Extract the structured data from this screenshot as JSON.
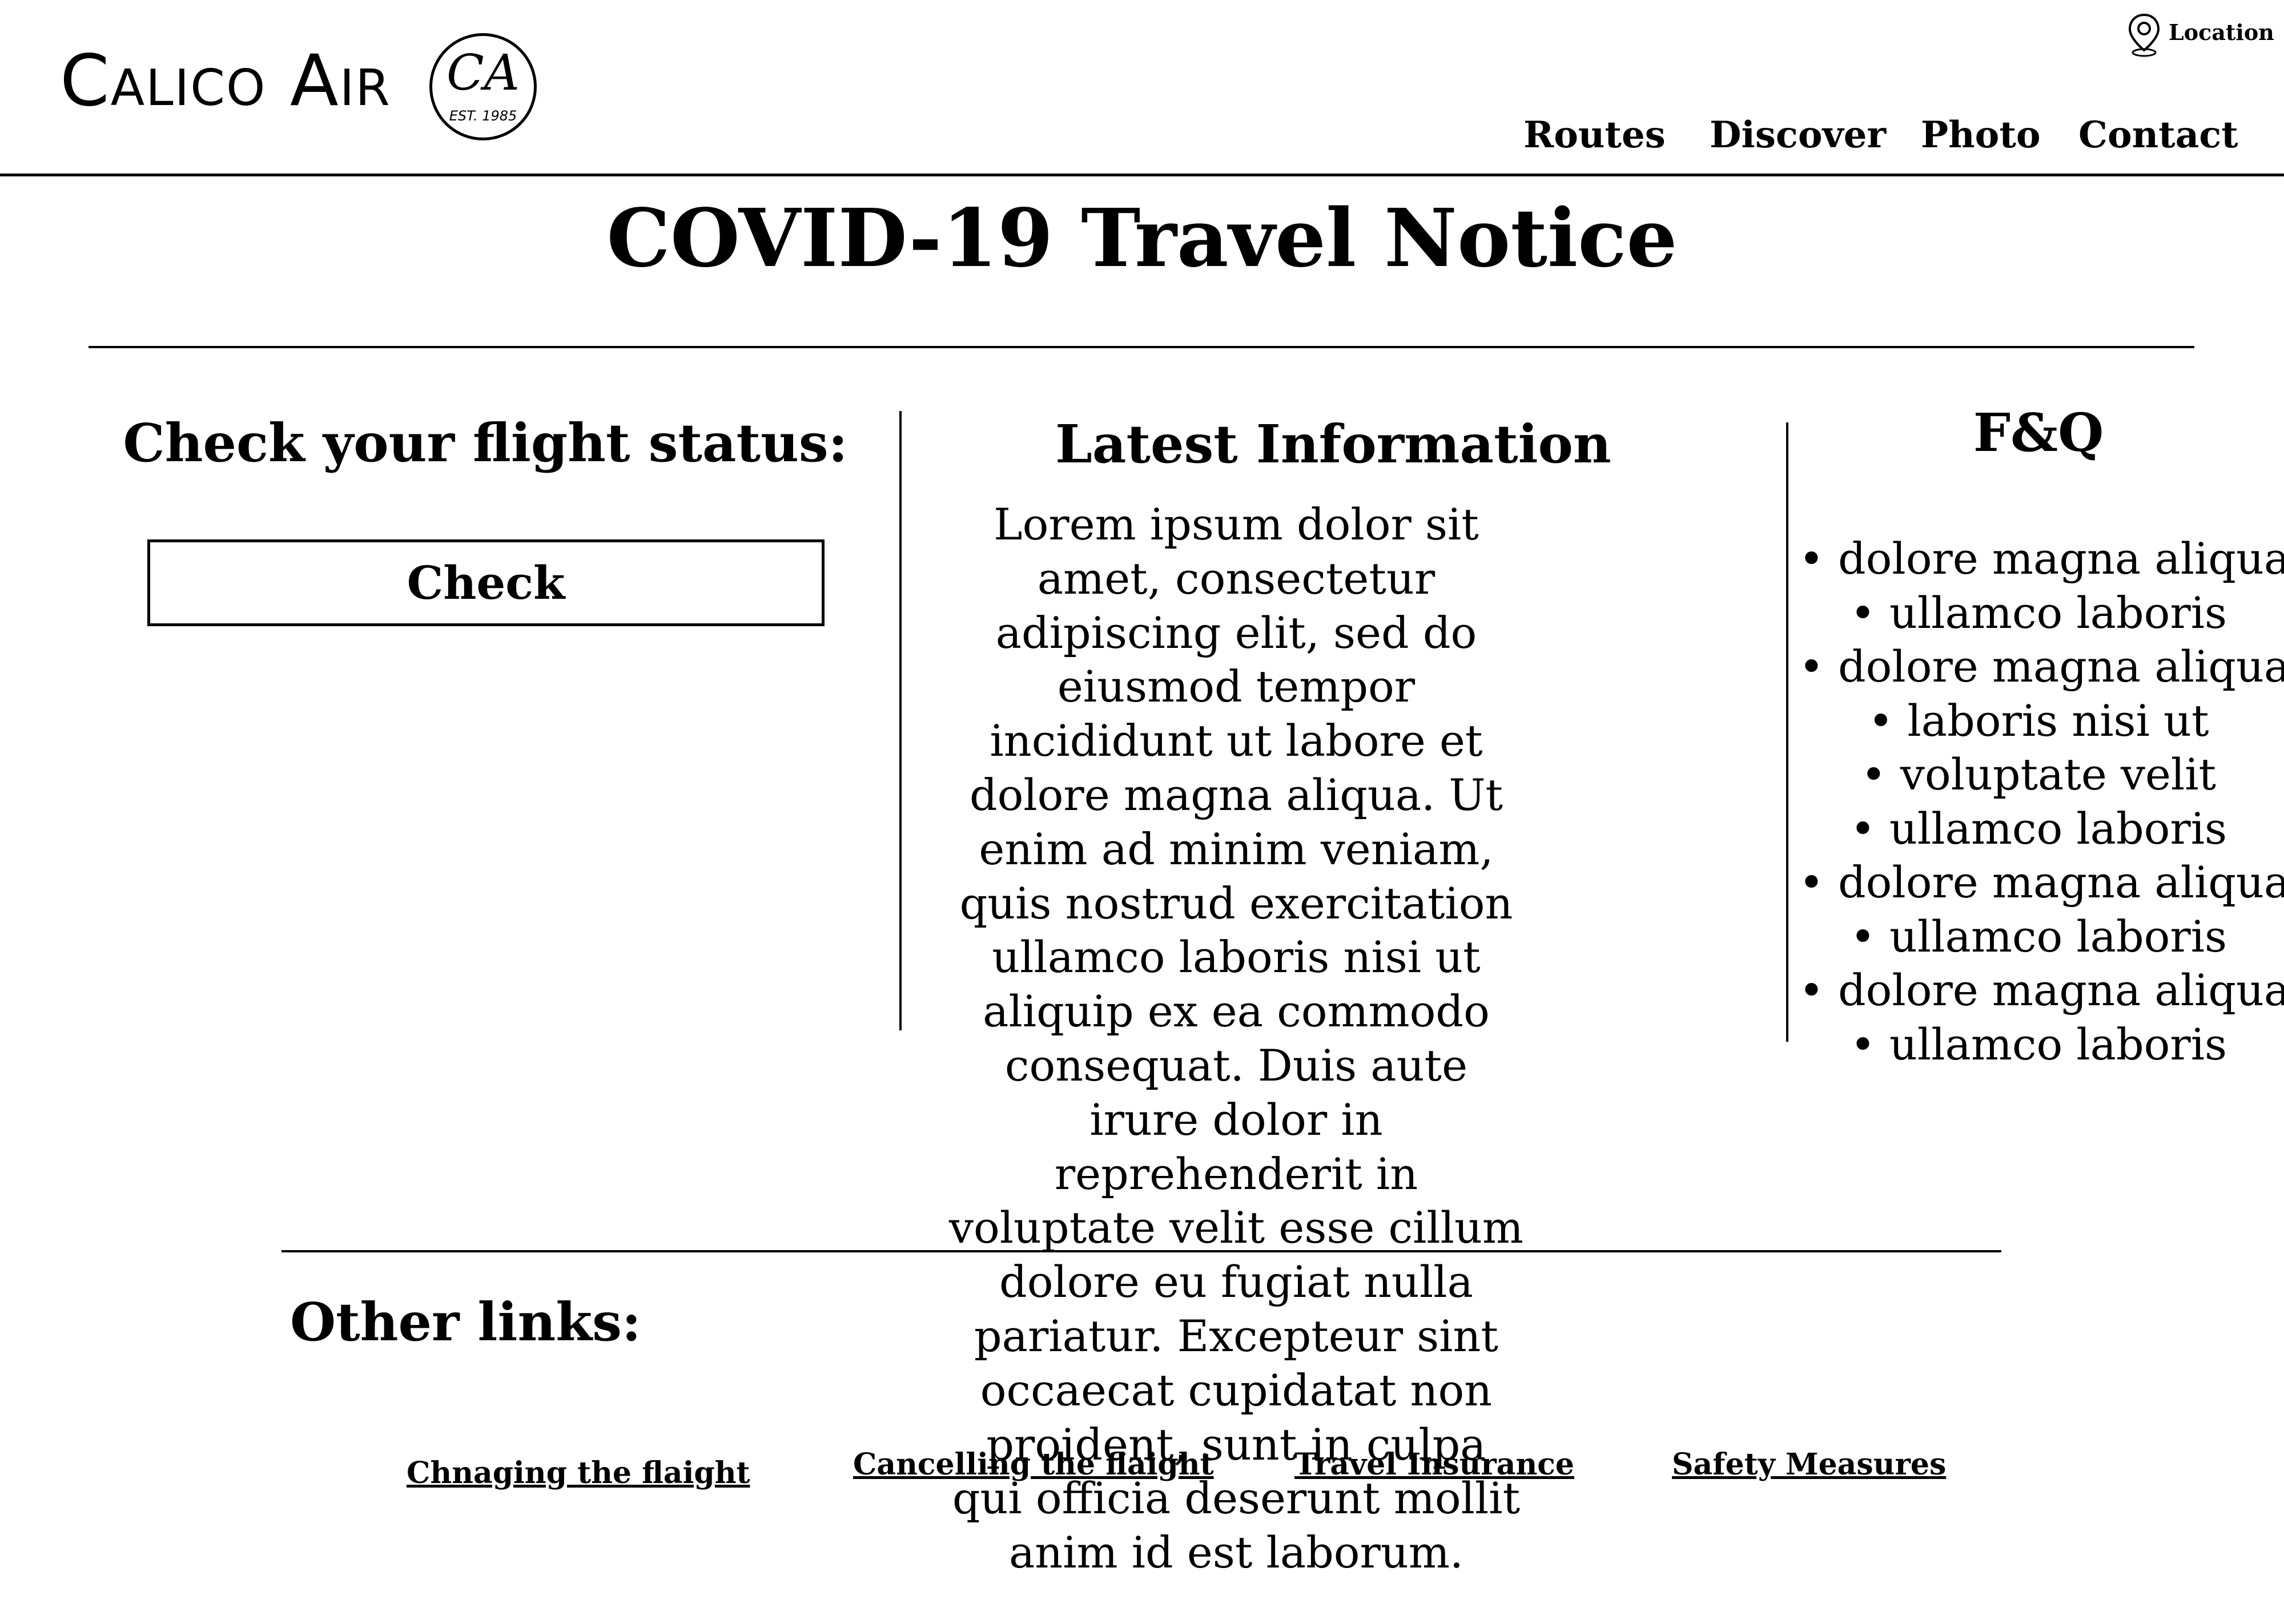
{
  "brand": {
    "name": "Calico Air",
    "logo_monogram": "CA",
    "logo_est": "EST. 1985"
  },
  "header": {
    "location_label": "Location",
    "nav": [
      "Routes",
      "Discover",
      "Photo",
      "Contact"
    ]
  },
  "page": {
    "title": "COVID-19 Travel Notice"
  },
  "flight_status": {
    "heading": "Check your flight status:",
    "button_label": "Check"
  },
  "latest": {
    "heading": "Latest Information",
    "body": "Lorem ipsum dolor sit amet, consectetur adipiscing elit, sed do eiusmod tempor incididunt ut labore et dolore magna aliqua. Ut enim ad minim veniam, quis nostrud exercitation ullamco laboris nisi ut aliquip ex ea commodo consequat. Duis aute irure dolor in reprehenderit in voluptate velit esse cillum dolore eu fugiat nulla pariatur. Excepteur sint occaecat cupidatat non proident, sunt in culpa qui officia deserunt mollit anim id est laborum."
  },
  "faq": {
    "heading": "F&Q",
    "items": [
      "dolore magna aliqua",
      "ullamco laboris",
      "dolore magna aliqua",
      "laboris nisi ut",
      "voluptate velit",
      "ullamco laboris",
      "dolore magna aliqua",
      "ullamco laboris",
      "dolore magna aliqua",
      "ullamco laboris"
    ]
  },
  "other_links": {
    "heading": "Other links:",
    "links": [
      "Chnaging the flaight",
      "Cancelling the flaight",
      "Travel Insurance",
      "Safety Measures"
    ]
  },
  "icons": {
    "location": "map-pin-icon"
  }
}
